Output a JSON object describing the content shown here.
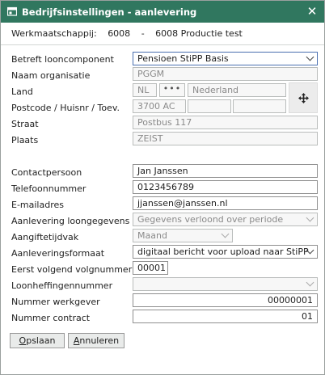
{
  "window": {
    "title": "Bedrijfsinstellingen - aanlevering",
    "close_symbol": "✕"
  },
  "company": {
    "label": "Werkmaatschappij:",
    "code": "6008",
    "separator": "-",
    "name": "6008 Productie test"
  },
  "form": {
    "looncomponent": {
      "label": "Betreft looncomponent",
      "value": "Pensioen StiPP Basis"
    },
    "naam_organisatie": {
      "label": "Naam organisatie",
      "value": "PGGM"
    },
    "land": {
      "label": "Land",
      "code": "NL",
      "lookup": "•••",
      "name": "Nederland"
    },
    "postcode": {
      "label": "Postcode / Huisnr / Toev.",
      "postcode": "3700 AC",
      "huisnr": "",
      "toevoeging": ""
    },
    "straat": {
      "label": "Straat",
      "value": "Postbus 117"
    },
    "plaats": {
      "label": "Plaats",
      "value": "ZEIST"
    },
    "contactpersoon": {
      "label": "Contactpersoon",
      "value": "Jan Janssen"
    },
    "telefoon": {
      "label": "Telefoonnummer",
      "value": "0123456789"
    },
    "email": {
      "label": "E-mailadres",
      "value": "jjanssen@janssen.nl"
    },
    "aanlevering_loongegevens": {
      "label": "Aanlevering loongegevens",
      "value": "Gegevens verloond over periode"
    },
    "aangiftetijdvak": {
      "label": "Aangiftetijdvak",
      "value": "Maand"
    },
    "aanleveringsformaat": {
      "label": "Aanleveringsformaat",
      "value": "digitaal bericht voor upload naar StiPP"
    },
    "volgnummer": {
      "label": "Eerst volgend volgnummer",
      "value": "00001"
    },
    "loonheffingennummer": {
      "label": "Loonheffingennummer",
      "value": ""
    },
    "nummer_werkgever": {
      "label": "Nummer werkgever",
      "value": "00000001"
    },
    "nummer_contract": {
      "label": "Nummer contract",
      "value": "01"
    }
  },
  "buttons": {
    "save": {
      "label": "Opslaan",
      "first": "O",
      "rest": "pslaan"
    },
    "cancel": {
      "label": "Annuleren",
      "first": "A",
      "rest": "nnuleren"
    }
  },
  "colors": {
    "titlebar": "#30775f",
    "accent_border": "#4a6fb0"
  },
  "icons": [
    "settings-window-icon",
    "close-icon",
    "ellipsis-icon",
    "move-icon",
    "chevron-down-icon"
  ]
}
